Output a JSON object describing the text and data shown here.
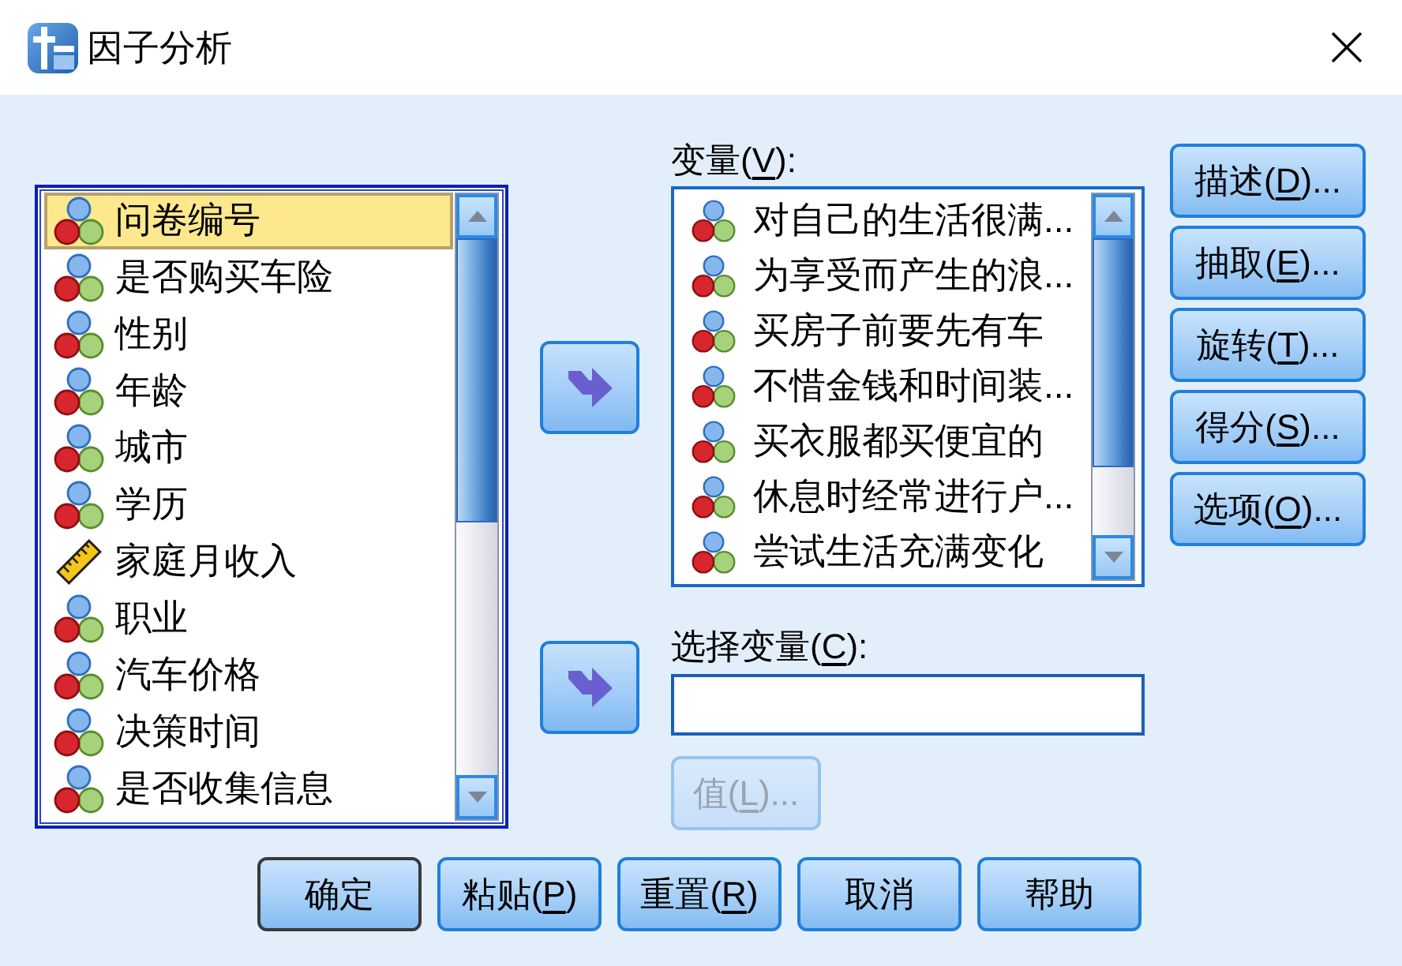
{
  "window": {
    "title": "因子分析"
  },
  "source_list": {
    "items": [
      {
        "label": "问卷编号",
        "kind": "nominal",
        "selected": true
      },
      {
        "label": "是否购买车险",
        "kind": "nominal",
        "selected": false
      },
      {
        "label": "性别",
        "kind": "nominal",
        "selected": false
      },
      {
        "label": "年龄",
        "kind": "nominal",
        "selected": false
      },
      {
        "label": "城市",
        "kind": "nominal",
        "selected": false
      },
      {
        "label": "学历",
        "kind": "nominal",
        "selected": false
      },
      {
        "label": "家庭月收入",
        "kind": "scale",
        "selected": false
      },
      {
        "label": "职业",
        "kind": "nominal",
        "selected": false
      },
      {
        "label": "汽车价格",
        "kind": "nominal",
        "selected": false
      },
      {
        "label": "决策时间",
        "kind": "nominal",
        "selected": false
      },
      {
        "label": "是否收集信息",
        "kind": "nominal",
        "selected": false
      }
    ]
  },
  "variables": {
    "label": {
      "text": "变量(",
      "key": "V",
      "after": "):"
    },
    "items": [
      {
        "label": "对自己的生活很满...",
        "kind": "nominal",
        "selected": false
      },
      {
        "label": "为享受而产生的浪...",
        "kind": "nominal",
        "selected": false
      },
      {
        "label": "买房子前要先有车",
        "kind": "nominal",
        "selected": false
      },
      {
        "label": "不惜金钱和时间装...",
        "kind": "nominal",
        "selected": false
      },
      {
        "label": "买衣服都买便宜的",
        "kind": "nominal",
        "selected": false
      },
      {
        "label": "休息时经常进行户...",
        "kind": "nominal",
        "selected": false
      },
      {
        "label": "尝试生活充满变化",
        "kind": "nominal",
        "selected": false
      }
    ]
  },
  "selection_variable": {
    "label": {
      "text": "选择变量(",
      "key": "C",
      "after": "):"
    },
    "value_button": {
      "label": {
        "text": "值(",
        "key": "L",
        "after": ")..."
      },
      "disabled": true
    }
  },
  "side_buttons": [
    {
      "label": {
        "text": "描述(",
        "key": "D",
        "after": ")..."
      }
    },
    {
      "label": {
        "text": "抽取(",
        "key": "E",
        "after": ")..."
      }
    },
    {
      "label": {
        "text": "旋转(",
        "key": "T",
        "after": ")..."
      }
    },
    {
      "label": {
        "text": "得分(",
        "key": "S",
        "after": ")..."
      }
    },
    {
      "label": {
        "text": "选项(",
        "key": "O",
        "after": ")..."
      }
    }
  ],
  "action_buttons": [
    {
      "label": {
        "text": "确定"
      },
      "default": true
    },
    {
      "label": {
        "text": "粘贴(",
        "key": "P",
        "after": ")"
      },
      "default": false
    },
    {
      "label": {
        "text": "重置(",
        "key": "R",
        "after": ")"
      },
      "default": false
    },
    {
      "label": {
        "text": "取消"
      },
      "default": false
    },
    {
      "label": {
        "text": "帮助"
      },
      "default": false
    }
  ]
}
